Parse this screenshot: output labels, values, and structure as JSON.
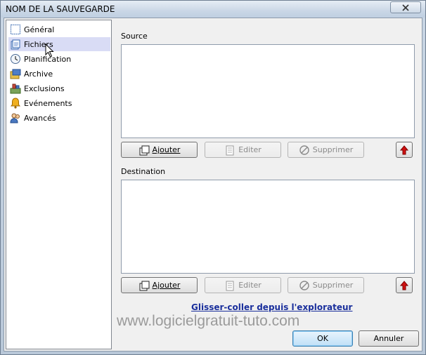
{
  "window": {
    "title": "NOM DE LA SAUVEGARDE"
  },
  "sidebar": {
    "items": [
      {
        "label": "Général",
        "icon": "general-icon"
      },
      {
        "label": "Fichiers",
        "icon": "files-icon",
        "selected": true
      },
      {
        "label": "Planification",
        "icon": "clock-icon"
      },
      {
        "label": "Archive",
        "icon": "archive-icon"
      },
      {
        "label": "Exclusions",
        "icon": "exclusions-icon"
      },
      {
        "label": "Evénements",
        "icon": "bell-icon"
      },
      {
        "label": "Avancés",
        "icon": "users-icon"
      }
    ]
  },
  "source": {
    "label": "Source",
    "add": "Ajouter",
    "edit": "Editer",
    "delete": "Supprimer"
  },
  "destination": {
    "label": "Destination",
    "add": "Ajouter",
    "edit": "Editer",
    "delete": "Supprimer"
  },
  "link": "Glisser-coller depuis l'explorateur",
  "watermark": "www.logicielgratuit-tuto.com",
  "footer": {
    "ok": "OK",
    "cancel": "Annuler"
  },
  "colors": {
    "selection": "#d9dcf5",
    "link": "#1a2f9c",
    "up_arrow": "#d01010"
  }
}
